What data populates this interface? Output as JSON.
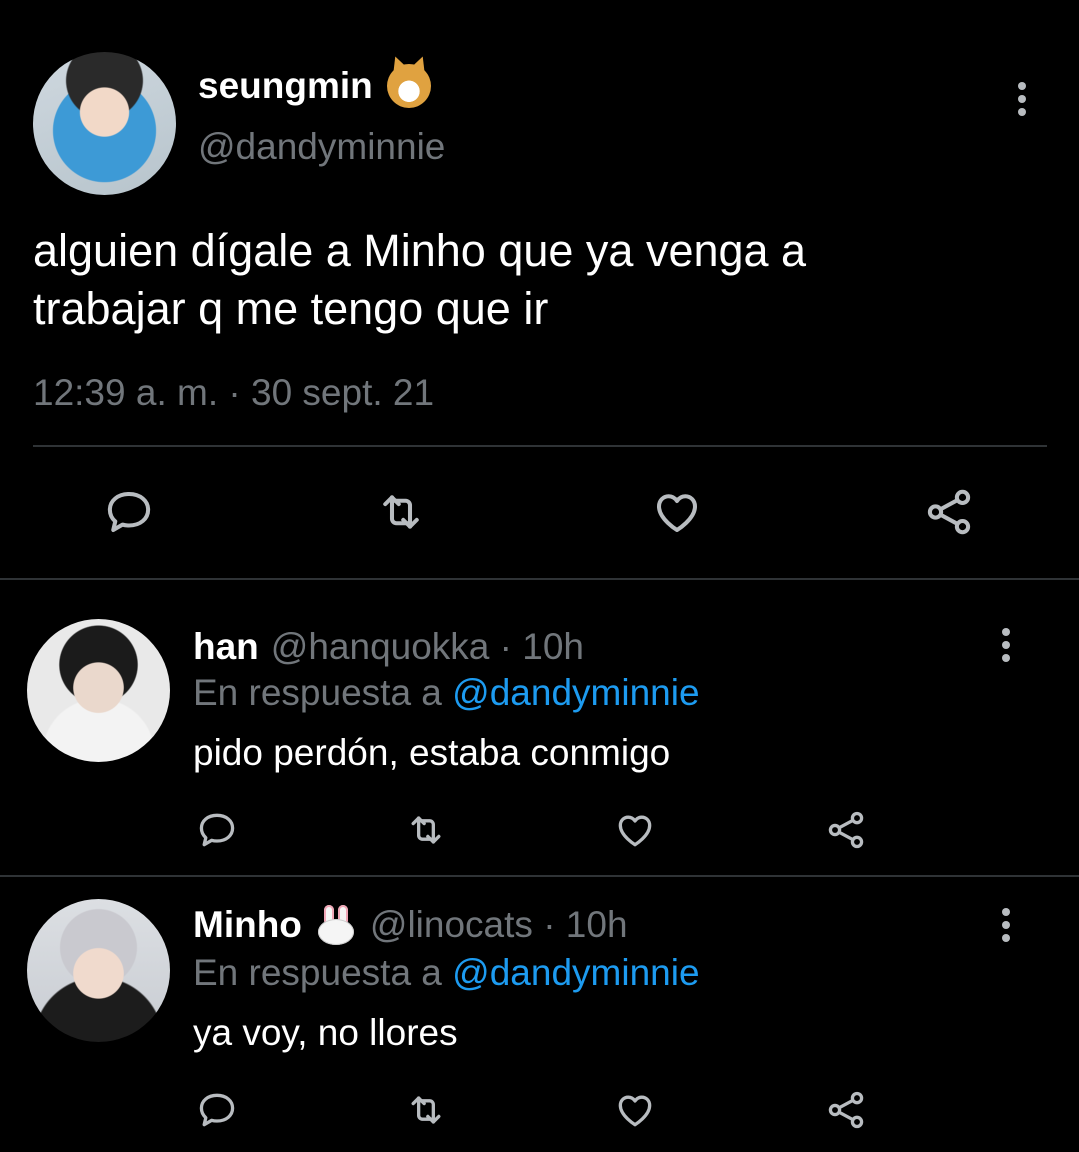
{
  "main_tweet": {
    "display_name": "seungmin",
    "name_emoji": "dog-face-icon",
    "handle": "@dandyminnie",
    "text_lines": [
      "alguien dígale a Minho que ya venga a",
      "trabajar q me tengo que ir"
    ],
    "timestamp": "12:39 a. m. · 30 sept. 21"
  },
  "replies": [
    {
      "display_name": "han",
      "meta": "@hanquokka · 10h",
      "reply_prefix": "En respuesta a ",
      "reply_to": "@dandyminnie",
      "text": "pido perdón, estaba conmigo"
    },
    {
      "display_name": "Minho",
      "name_emoji": "rabbit-face-icon",
      "meta": "@linocats · 10h",
      "reply_prefix": "En respuesta a ",
      "reply_to": "@dandyminnie",
      "text": "ya voy, no llores"
    }
  ],
  "actions": [
    "reply-icon",
    "retweet-icon",
    "like-icon",
    "share-icon"
  ],
  "colors": {
    "background": "#000000",
    "text": "#ffffff",
    "secondary": "#71767b",
    "link": "#1d9bf0",
    "icon": "#b8bcc0",
    "divider": "#2f3336"
  }
}
